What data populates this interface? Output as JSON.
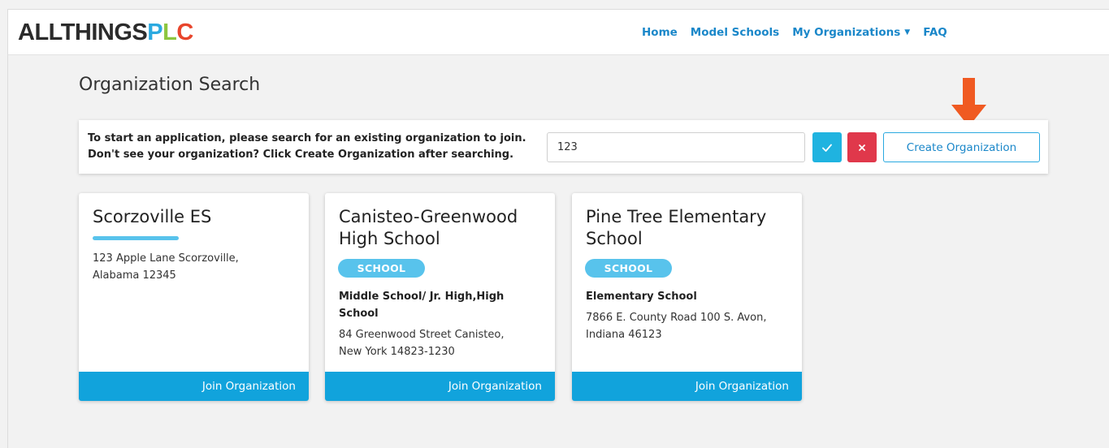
{
  "brand": {
    "part1": "ALLTHINGS",
    "part2": "P",
    "part3": "L",
    "part4": "C"
  },
  "nav": {
    "home": "Home",
    "model_schools": "Model Schools",
    "my_organizations": "My Organizations",
    "faq": "FAQ"
  },
  "page": {
    "title": "Organization Search"
  },
  "search": {
    "instruction_line1": "To start an application, please search for an existing organization to join.",
    "instruction_line2": "Don't see your organization? Click Create Organization after searching.",
    "value": "123",
    "create_label": "Create Organization"
  },
  "colors": {
    "accent_blue": "#11a3dc",
    "check_button": "#1fb3e0",
    "clear_button": "#e0384b",
    "annotation_arrow": "#f05a22"
  },
  "results": [
    {
      "name": "Scorzoville ES",
      "badge": "",
      "type": "",
      "address_line1": "123 Apple Lane Scorzoville,",
      "address_line2": "Alabama 12345",
      "join_label": "Join Organization"
    },
    {
      "name_line1": "Canisteo-Greenwood",
      "name_line2": "High School",
      "badge": "SCHOOL",
      "type_line1": "Middle School/ Jr. High,High",
      "type_line2": "School",
      "address_line1": "84 Greenwood Street Canisteo,",
      "address_line2": "New York 14823-1230",
      "join_label": "Join Organization"
    },
    {
      "name_line1": "Pine Tree Elementary",
      "name_line2": "School",
      "badge": "SCHOOL",
      "type": "Elementary School",
      "address_line1": "7866 E. County Road 100 S. Avon,",
      "address_line2": "Indiana 46123",
      "join_label": "Join Organization"
    }
  ]
}
